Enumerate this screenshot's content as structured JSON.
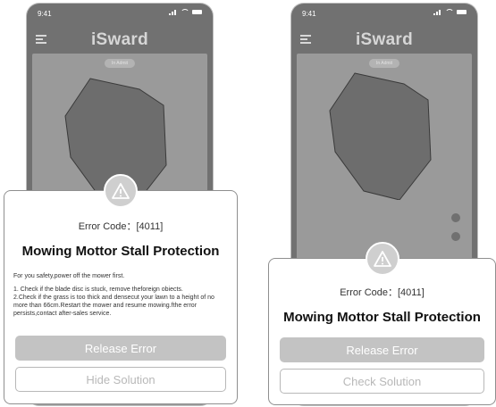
{
  "status": {
    "time": "9:41"
  },
  "app": {
    "title": "iSward",
    "pill": "In Admit"
  },
  "screen_a": {
    "error_code": "Error Code：[4011]",
    "title": "Mowing Mottor Stall Protection",
    "intro": "For you safety,power off the mower first.",
    "steps": [
      "1. Check if the blade disc is stuck, remove theforeign obiects.",
      "2.Check if the grass is too thick and densecut your lawn to a height of no more than 66cm.Restart the mower and resume mowing.fthe error persists,contact after-sales service."
    ],
    "primary_button": "Release Error",
    "secondary_button": "Hide Solution"
  },
  "screen_b": {
    "error_code": "Error Code：[4011]",
    "title": "Mowing Mottor Stall Protection",
    "primary_button": "Release Error",
    "secondary_button": "Check Solution"
  },
  "colors": {
    "overlay": "#717171",
    "map": "#9a9a9a",
    "yard": "#6d6d6d",
    "button_primary": "#c3c3c3",
    "button_outline": "#b8b8b8"
  },
  "icons": [
    "menu-icon",
    "warning-icon",
    "signal-icon",
    "wifi-icon",
    "battery-icon"
  ]
}
